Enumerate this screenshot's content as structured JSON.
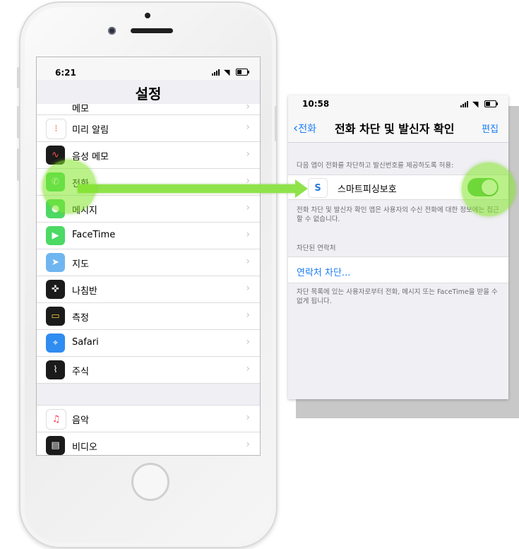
{
  "left_screen": {
    "status_time": "6:21",
    "title": "설정",
    "rows": [
      {
        "label": "메모",
        "icon": "notes-icon",
        "color": "#ffffff",
        "glyph": "≡"
      },
      {
        "label": "미리 알림",
        "icon": "reminders-icon",
        "color": "#ffffff",
        "glyph": "•"
      },
      {
        "label": "음성 메모",
        "icon": "voice-memos-icon",
        "color": "#1b1b1b",
        "glyph": "∿"
      },
      {
        "label": "전화",
        "icon": "phone-icon",
        "color": "#4cd964",
        "glyph": "✆"
      },
      {
        "label": "메시지",
        "icon": "messages-icon",
        "color": "#4cd964",
        "glyph": "●"
      },
      {
        "label": "FaceTime",
        "icon": "facetime-icon",
        "color": "#4cd964",
        "glyph": "▶"
      },
      {
        "label": "지도",
        "icon": "maps-icon",
        "color": "#6fb6f0",
        "glyph": "➤"
      },
      {
        "label": "나침반",
        "icon": "compass-icon",
        "color": "#1b1b1b",
        "glyph": "✜"
      },
      {
        "label": "측정",
        "icon": "measure-icon",
        "color": "#1b1b1b",
        "glyph": "▭"
      },
      {
        "label": "Safari",
        "icon": "safari-icon",
        "color": "#2f8cf0",
        "glyph": "⌖"
      },
      {
        "label": "주식",
        "icon": "stocks-icon",
        "color": "#1b1b1b",
        "glyph": "⌇"
      },
      {
        "label": "음악",
        "icon": "music-icon",
        "color": "#ffffff",
        "glyph": "♫"
      },
      {
        "label": "비디오",
        "icon": "videos-icon",
        "color": "#1b1b1b",
        "glyph": "▤"
      }
    ]
  },
  "right_screen": {
    "status_time": "10:58",
    "back_label": "전화",
    "title": "전화 차단 및 발신자 확인",
    "edit_label": "편집",
    "allow_caption": "다음 앱이 전화를 차단하고 발신번호를 제공하도록 허용:",
    "app_name": "스마트피싱보호",
    "app_toggle_on": true,
    "info_caption": "전화 차단 및 발신자 확인 앱은 사용자의 수신 전화에 대한 정보에는 접근할 수 없습니다.",
    "blocked_header": "차단된 연락처",
    "block_link": "연락처 차단...",
    "block_caption": "차단 목록에 있는 사용자로부터 전화, 메시지 또는 FaceTime을 받을 수 없게 됩니다."
  },
  "colors": {
    "accent": "#1a7cf5",
    "toggle_on": "#59c84e",
    "highlight": "#8fe34a"
  }
}
